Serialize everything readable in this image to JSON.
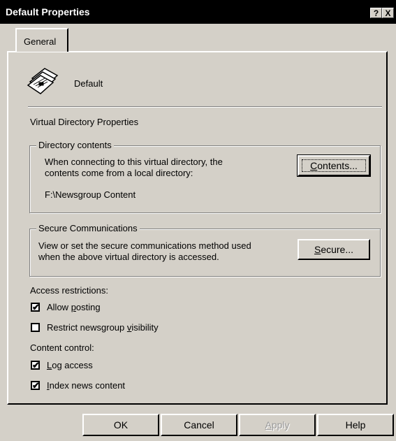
{
  "window": {
    "title": "Default Properties",
    "help_button": "?",
    "close_button": "X"
  },
  "tabs": [
    {
      "label": "General"
    }
  ],
  "header": {
    "name": "Default",
    "icon": "newsgroup-documents-icon"
  },
  "section_title": "Virtual Directory Properties",
  "directory_contents": {
    "legend": "Directory contents",
    "description_line1": "When connecting to this virtual directory, the",
    "description_line2": "contents come from a local directory:",
    "path": "F:\\Newsgroup Content",
    "button": {
      "pre": "",
      "mnemonic": "C",
      "post": "ontents..."
    }
  },
  "secure_comm": {
    "legend": "Secure Communications",
    "description_line1": "View or set the secure communications method used",
    "description_line2": "when the above virtual directory is accessed.",
    "button": {
      "pre": "",
      "mnemonic": "S",
      "post": "ecure..."
    }
  },
  "access_restrictions": {
    "label": "Access restrictions:",
    "items": [
      {
        "pre": "Allow ",
        "mnemonic": "p",
        "post": "osting",
        "checked": true
      },
      {
        "pre": "Restrict newsgroup ",
        "mnemonic": "v",
        "post": "isibility",
        "checked": false
      }
    ]
  },
  "content_control": {
    "label": "Content control:",
    "items": [
      {
        "pre": "",
        "mnemonic": "L",
        "post": "og access",
        "checked": true
      },
      {
        "pre": "",
        "mnemonic": "I",
        "post": "ndex news content",
        "checked": true
      }
    ]
  },
  "footer": {
    "ok": "OK",
    "cancel": "Cancel",
    "apply": {
      "pre": "",
      "mnemonic": "A",
      "post": "pply",
      "enabled": false
    },
    "help": "Help"
  }
}
